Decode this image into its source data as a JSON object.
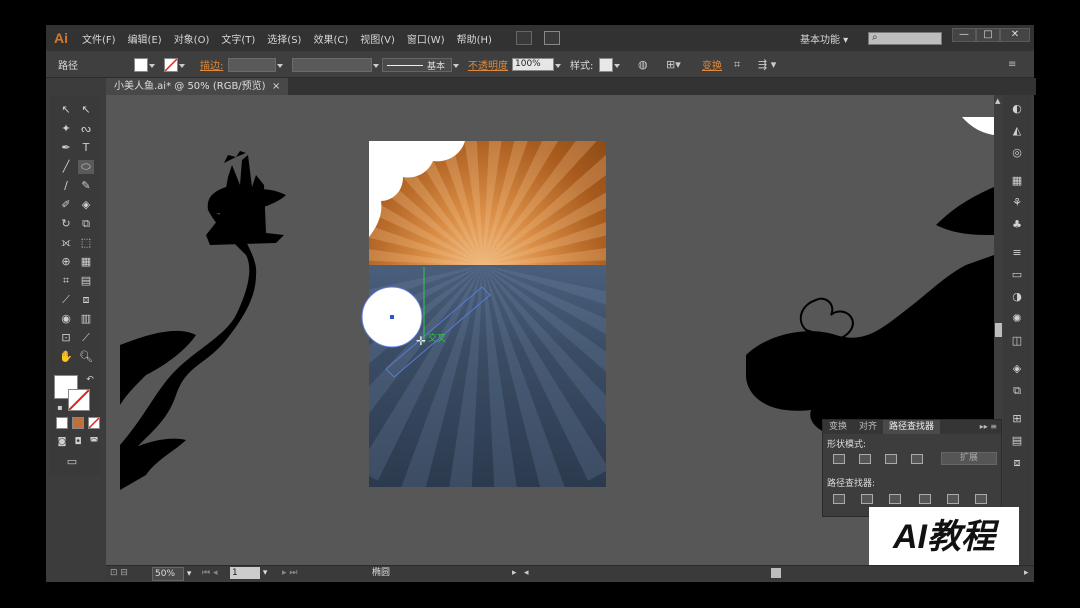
{
  "app": {
    "logo": "Ai"
  },
  "menu": [
    "文件(F)",
    "编辑(E)",
    "对象(O)",
    "文字(T)",
    "选择(S)",
    "效果(C)",
    "视图(V)",
    "窗口(W)",
    "帮助(H)"
  ],
  "workspace": {
    "label": "基本功能",
    "search_placeholder": ""
  },
  "window_controls": {
    "minimize": "—",
    "maximize": "□",
    "close": "✕"
  },
  "control_bar": {
    "object_type": "路径",
    "stroke_label": "描边:",
    "stroke_profile": "基本",
    "opacity_label": "不透明度",
    "opacity_value": "100%",
    "style_label": "样式:",
    "transform_label": "变换",
    "fill_color": "#ffffff"
  },
  "document_tab": {
    "title": "小美人鱼.ai* @ 50% (RGB/预览)",
    "close": "×"
  },
  "artboard": {
    "sky_colors": [
      "#f3c28a",
      "#d98d45",
      "#8e4b16"
    ],
    "sea_colors": [
      "#4a5f7c",
      "#2c3a4e"
    ],
    "smart_guide_label": "交叉"
  },
  "tools": {
    "fill": "#ffffff",
    "stroke": "none"
  },
  "right_strip_icons": [
    "color-guide-icon",
    "appearance-icon",
    "graphic-styles-icon",
    "swatches-icon",
    "brushes-icon",
    "symbols-icon",
    "stroke-icon",
    "gradient-icon",
    "transparency-icon",
    "appearance-sun-icon",
    "image-trace-icon",
    "layers-icon",
    "artboards-icon",
    "align-icon",
    "transform-icon",
    "pathfinder-icon"
  ],
  "pathfinder_panel": {
    "tabs": [
      "变换",
      "对齐",
      "路径查找器"
    ],
    "shape_modes_label": "形状模式:",
    "pathfinders_label": "路径查找器:",
    "expand_label": "扩展"
  },
  "watermark": {
    "text": "AI教程"
  },
  "status_bar": {
    "zoom": "50%",
    "artboard_number": "1",
    "tool_name": "椭圆"
  }
}
